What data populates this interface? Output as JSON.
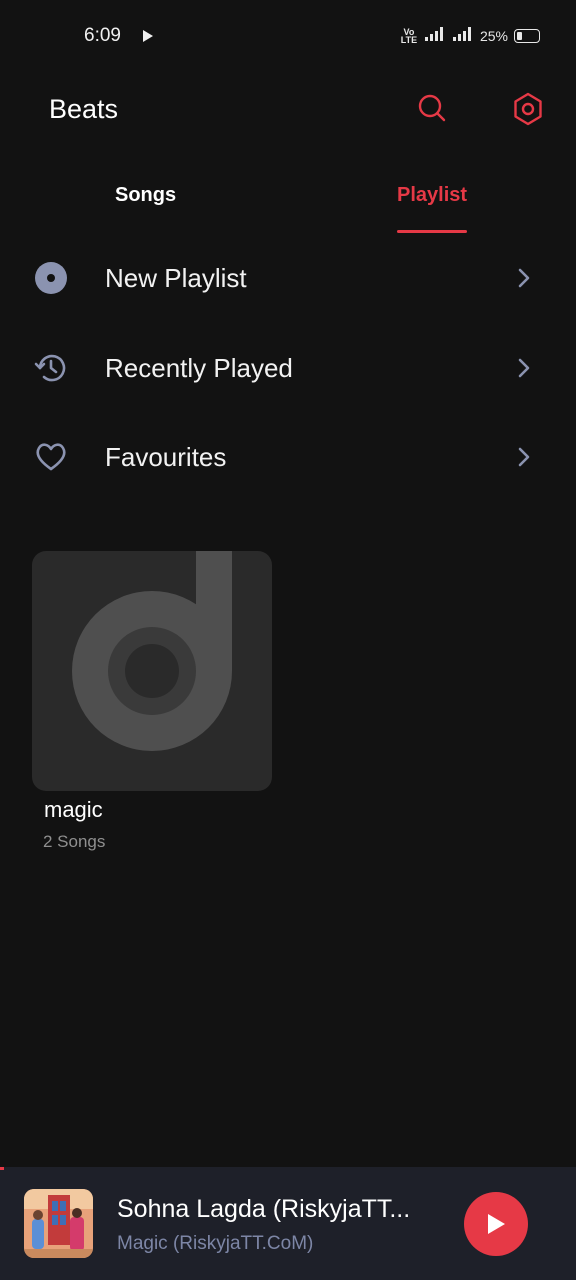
{
  "status_bar": {
    "time": "6:09",
    "network_label": "Vo LTE",
    "battery_text": "25%",
    "battery_level": 0.25
  },
  "header": {
    "title": "Beats",
    "search_icon": "search-icon",
    "settings_icon": "gear-icon"
  },
  "tabs": [
    {
      "label": "Songs",
      "active": false
    },
    {
      "label": "Playlist",
      "active": true
    }
  ],
  "menu": [
    {
      "label": "New Playlist",
      "icon": "disc-icon"
    },
    {
      "label": "Recently Played",
      "icon": "history-icon"
    },
    {
      "label": "Favourites",
      "icon": "heart-icon"
    }
  ],
  "playlists": [
    {
      "name": "magic",
      "count": "2 Songs"
    }
  ],
  "now_playing": {
    "title": "Sohna Lagda (RiskyjaTT...",
    "artist": "Magic (RiskyjaTT.CoM)"
  },
  "colors": {
    "accent": "#e63946",
    "background": "#121212",
    "icon_muted": "#7d86a6",
    "player_bg": "#1e2029"
  }
}
